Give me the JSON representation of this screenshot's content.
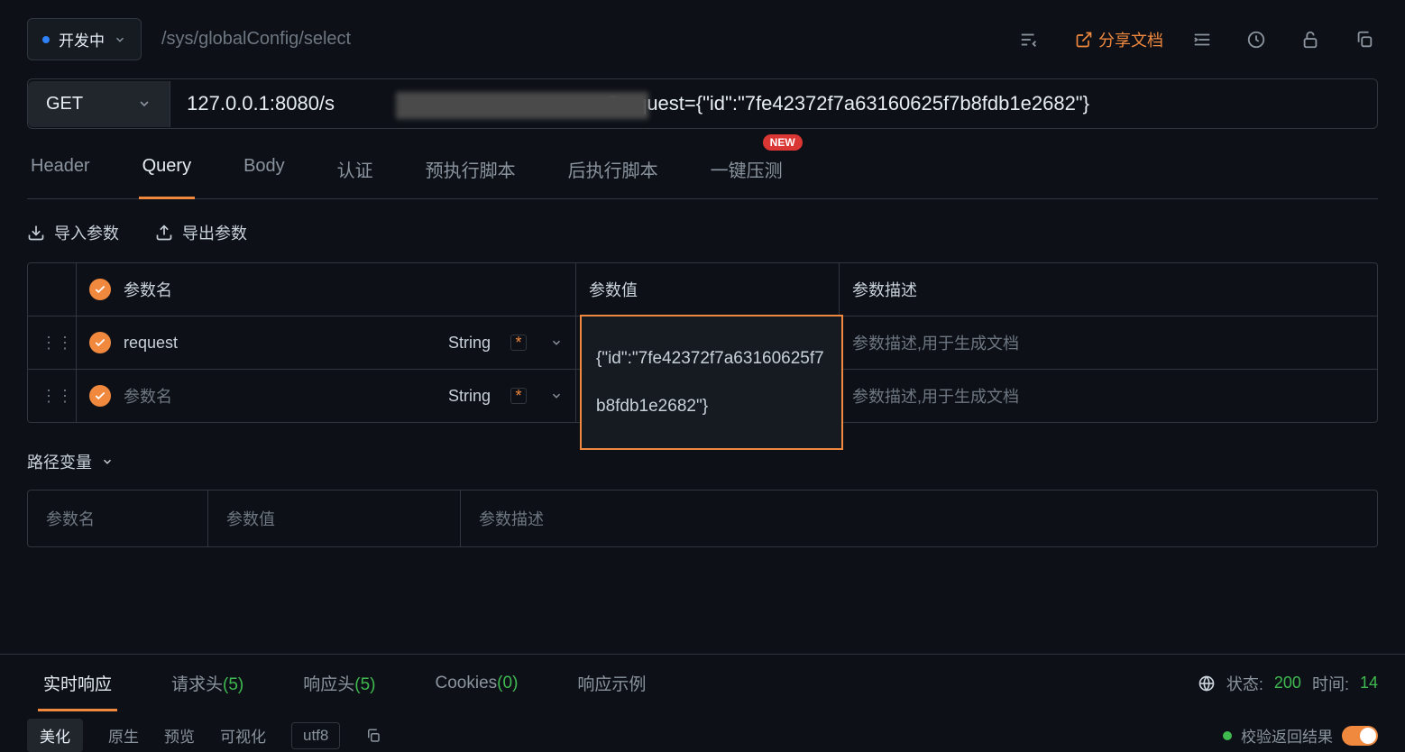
{
  "topbar": {
    "status_label": "开发中",
    "path": "/sys/globalConfig/select",
    "share_label": "分享文档"
  },
  "request": {
    "method": "GET",
    "url_prefix": "127.0.0.1:8080/s",
    "url_suffix": "t?request={\"id\":\"7fe42372f7a63160625f7b8fdb1e2682\"}"
  },
  "req_tabs": {
    "header": "Header",
    "query": "Query",
    "body": "Body",
    "auth": "认证",
    "pre_script": "预执行脚本",
    "post_script": "后执行脚本",
    "stress": "一键压测",
    "new_badge": "NEW"
  },
  "param_actions": {
    "import_label": "导入参数",
    "export_label": "导出参数"
  },
  "param_table": {
    "head_name": "参数名",
    "head_value": "参数值",
    "head_desc": "参数描述",
    "rows": [
      {
        "name": "request",
        "type": "String",
        "value": "{\"id\":\"7fe42372f7a63160625f7b8fdb1e2682\"}",
        "desc_placeholder": "参数描述,用于生成文档"
      },
      {
        "name_placeholder": "参数名",
        "type": "String",
        "desc_placeholder": "参数描述,用于生成文档"
      }
    ]
  },
  "path_vars": {
    "title": "路径变量",
    "col_name_placeholder": "参数名",
    "col_value_placeholder": "参数值",
    "col_desc_placeholder": "参数描述"
  },
  "resp_tabs": {
    "realtime": "实时响应",
    "req_header": "请求头",
    "req_header_count": "(5)",
    "resp_header": "响应头",
    "resp_header_count": "(5)",
    "cookies": "Cookies",
    "cookies_count": "(0)",
    "example": "响应示例"
  },
  "resp_status": {
    "status_label": "状态:",
    "status_code": "200",
    "time_label": "时间:",
    "time_value": "14"
  },
  "resp_sub": {
    "beautify": "美化",
    "raw": "原生",
    "preview": "预览",
    "visual": "可视化",
    "encoding": "utf8",
    "validate_label": "校验返回结果"
  }
}
